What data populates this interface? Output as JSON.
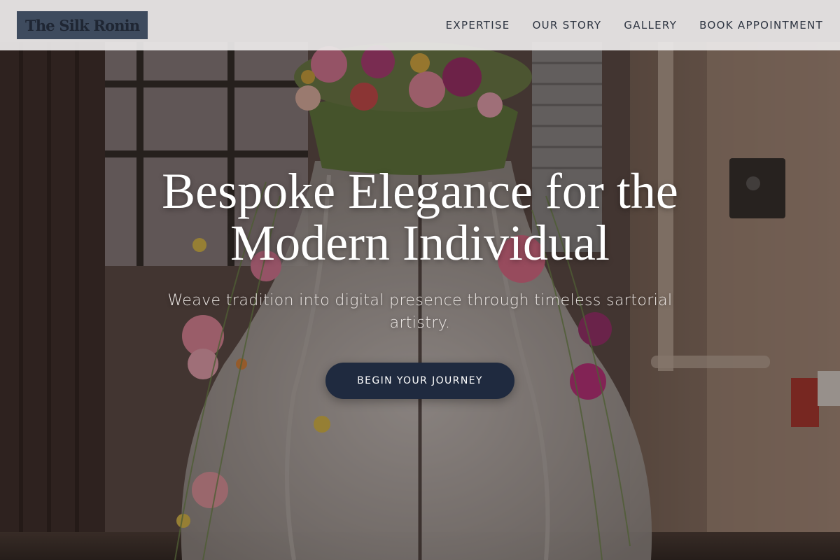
{
  "header": {
    "logo_text": "The Silk Ronin",
    "nav": [
      {
        "label": "EXPERTISE"
      },
      {
        "label": "OUR STORY"
      },
      {
        "label": "GALLERY"
      },
      {
        "label": "BOOK APPOINTMENT"
      }
    ]
  },
  "hero": {
    "title": "Bespoke Elegance for the Modern Individual",
    "subtitle": "Weave tradition into digital presence through timeless sartorial artistry.",
    "cta_label": "BEGIN YOUR JOURNEY",
    "image_description_icon": "floral-dress-mannequin-photo"
  },
  "colors": {
    "header_bg": "#eceae9",
    "logo_bg": "#3e4b5e",
    "cta_bg": "#1f2a3f",
    "nav_text": "#2c3340",
    "hero_text": "#ffffff"
  }
}
